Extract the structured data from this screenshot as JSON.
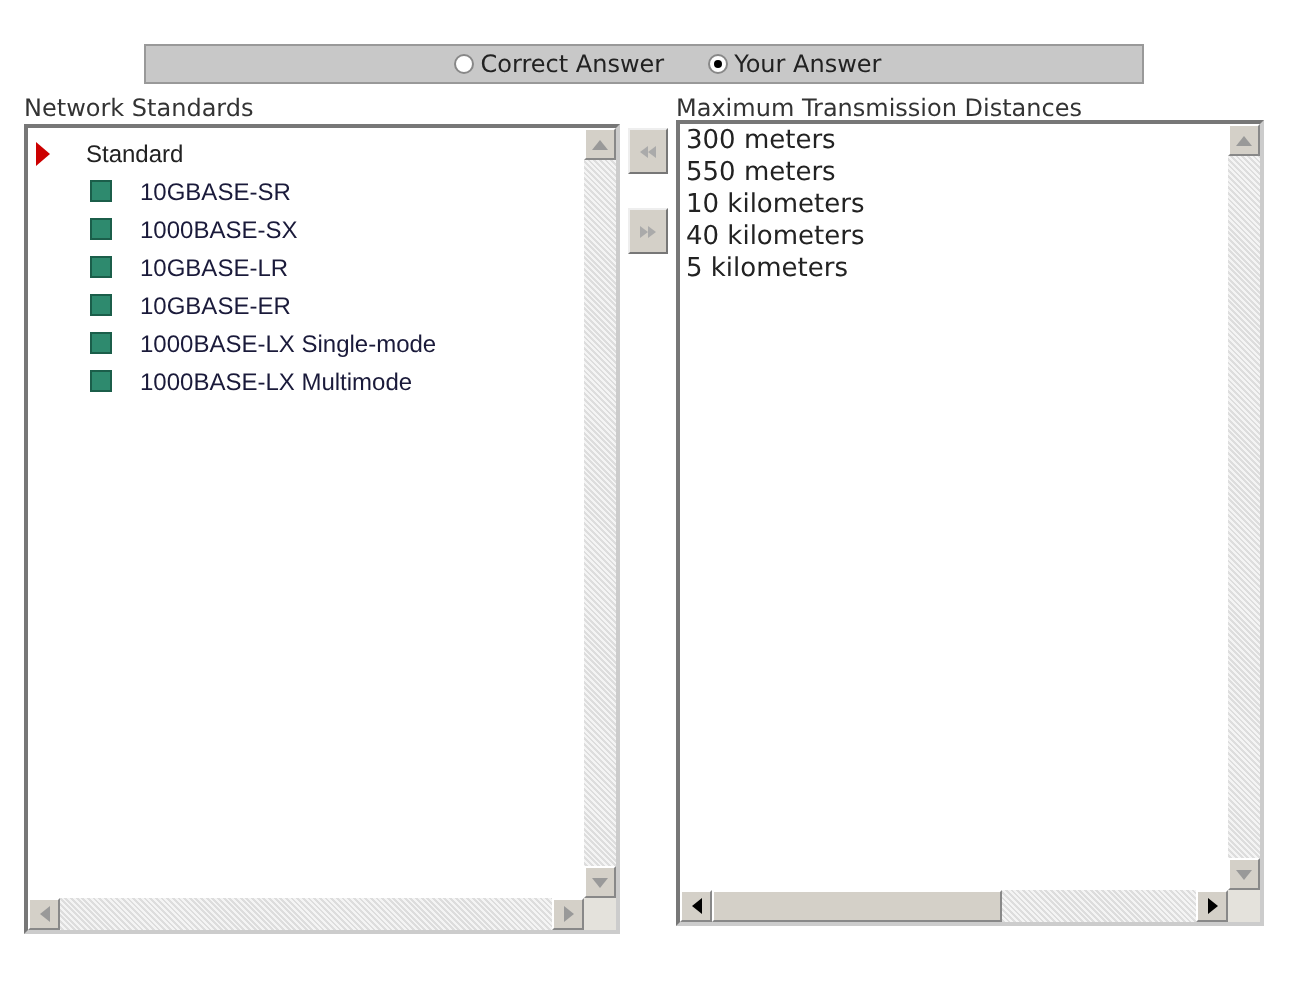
{
  "answer_toggle": [
    {
      "label": "Correct Answer",
      "selected": false
    },
    {
      "label": "Your Answer",
      "selected": true
    }
  ],
  "left_list": {
    "title": "Network Standards",
    "tree": [
      {
        "label": "Standard",
        "expanded": true,
        "children": [
          {
            "label": "10GBASE-SR"
          },
          {
            "label": "1000BASE-SX"
          },
          {
            "label": "10GBASE-LR"
          },
          {
            "label": "10GBASE-ER"
          },
          {
            "label": "1000BASE-LX Single-mode"
          },
          {
            "label": "1000BASE-LX Multimode"
          }
        ]
      }
    ]
  },
  "right_list": {
    "title": "Maximum Transmission Distances",
    "items": [
      "300 meters",
      "550 meters",
      "10 kilometers",
      "40 kilometers",
      "5 kilometers"
    ]
  }
}
